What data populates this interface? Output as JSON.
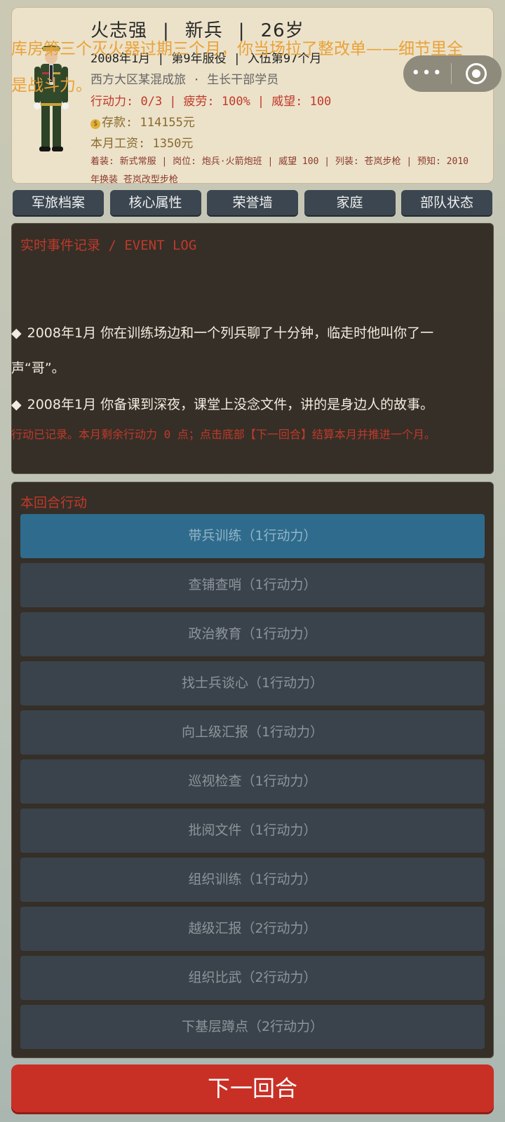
{
  "profile": {
    "name": "火志强",
    "rank": "新兵",
    "age": "26岁",
    "date": "2008年1月",
    "service_year": "第9年服役",
    "enlist_month": "入伍第97个月",
    "unit": "西方大区某混成旅",
    "unit_dot": "·",
    "background": "生长干部学员",
    "action_points": "行动力: 0/3",
    "fatigue": "疲劳: 100%",
    "prestige": "威望: 100",
    "savings": "存款: 114155元",
    "salary": "本月工资: 1350元",
    "details": "着装: 新式常服 | 岗位: 炮兵·火箭炮班 | 威望 100 | 列装: 苍岚步枪 | 预知: 2010年换装 苍岚改型步枪",
    "coin_icon": "$"
  },
  "capsule": {
    "more_label": "•••"
  },
  "tabs": [
    "军旅档案",
    "核心属性",
    "荣誉墙",
    "家庭",
    "部队状态"
  ],
  "event_log": {
    "title": "实时事件记录 / EVENT LOG",
    "headline": "库房第三个灭火器过期三个月，你当场拉了整改单——细节里全是战斗力。",
    "entries": [
      "2008年1月 你在训练场边和一个列兵聊了十分钟，临走时他叫你了一声“哥”。",
      "2008年1月 你备课到深夜，课堂上没念文件，讲的是身边人的故事。"
    ],
    "bullet": "◆",
    "note": "行动已记录。本月剩余行动力 0 点；点击底部【下一回合】结算本月并推进一个月。"
  },
  "actions": {
    "title": "本回合行动",
    "items": [
      "带兵训练（1行动力）",
      "查铺查哨（1行动力）",
      "政治教育（1行动力）",
      "找士兵谈心（1行动力）",
      "向上级汇报（1行动力）",
      "巡视检查（1行动力）",
      "批阅文件（1行动力）",
      "组织训练（1行动力）",
      "越级汇报（2行动力）",
      "组织比武（2行动力）",
      "下基层蹲点（2行动力）"
    ]
  },
  "next_turn_label": "下一回合",
  "colors": {
    "card_bg": "#ece2c9",
    "panel_bg": "#352f27",
    "accent_red": "#c0392b",
    "headline_orange": "#e8a23a",
    "active_action": "#2f6b8c",
    "tab_bg": "#3b4650"
  }
}
